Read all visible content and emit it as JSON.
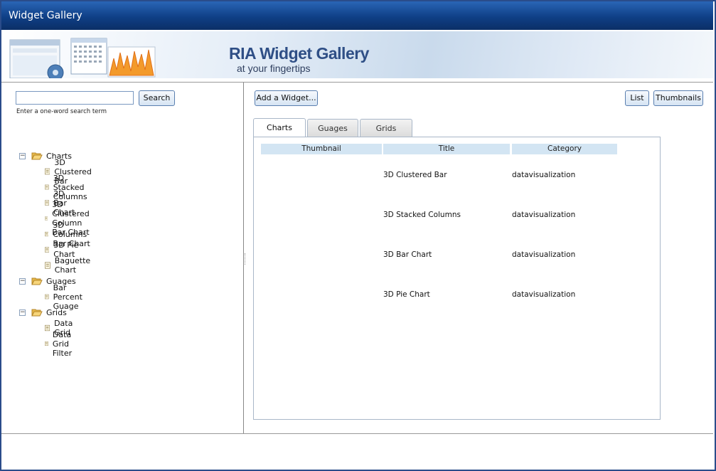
{
  "app": {
    "title": "Widget Gallery"
  },
  "banner": {
    "headline": "RIA Widget Gallery",
    "tagline": "at your fingertips"
  },
  "search": {
    "value": "",
    "button_label": "Search",
    "hint": "Enter a one-word search term"
  },
  "tree": [
    {
      "label": "Charts",
      "expanded": true,
      "items": [
        "3D Clustered Bar",
        "3D Stacked Columns",
        "3D Bar Chart",
        "3D Clustered Column Bar Chart",
        "3D Columns Bar Chart",
        "3D Pie Chart",
        "Baguette Chart"
      ]
    },
    {
      "label": "Guages",
      "expanded": true,
      "items": [
        "Bar Percent Guage"
      ]
    },
    {
      "label": "Grids",
      "expanded": true,
      "items": [
        "Data Grid",
        "Data Grid Filter"
      ]
    }
  ],
  "toolbar": {
    "add_widget_label": "Add a Widget...",
    "list_label": "List",
    "thumbnails_label": "Thumbnails"
  },
  "tabs": [
    {
      "label": "Charts",
      "active": true
    },
    {
      "label": "Guages",
      "active": false
    },
    {
      "label": "Grids",
      "active": false
    }
  ],
  "table": {
    "columns": [
      "Thumbnail",
      "Title",
      "Category"
    ],
    "rows": [
      {
        "thumbnail": "",
        "title": "3D Clustered Bar",
        "category": "datavisualization"
      },
      {
        "thumbnail": "",
        "title": "3D Stacked Columns",
        "category": "datavisualization"
      },
      {
        "thumbnail": "",
        "title": "3D Bar Chart",
        "category": "datavisualization"
      },
      {
        "thumbnail": "",
        "title": "3D Pie Chart",
        "category": "datavisualization"
      }
    ]
  },
  "icons": {
    "expander": "collapse-icon",
    "folder": "folder-open-icon",
    "document": "document-icon"
  },
  "colors": {
    "titlebar": "#0f3f86",
    "header_cell": "#d3e5f3",
    "accent": "#2f4f86"
  }
}
